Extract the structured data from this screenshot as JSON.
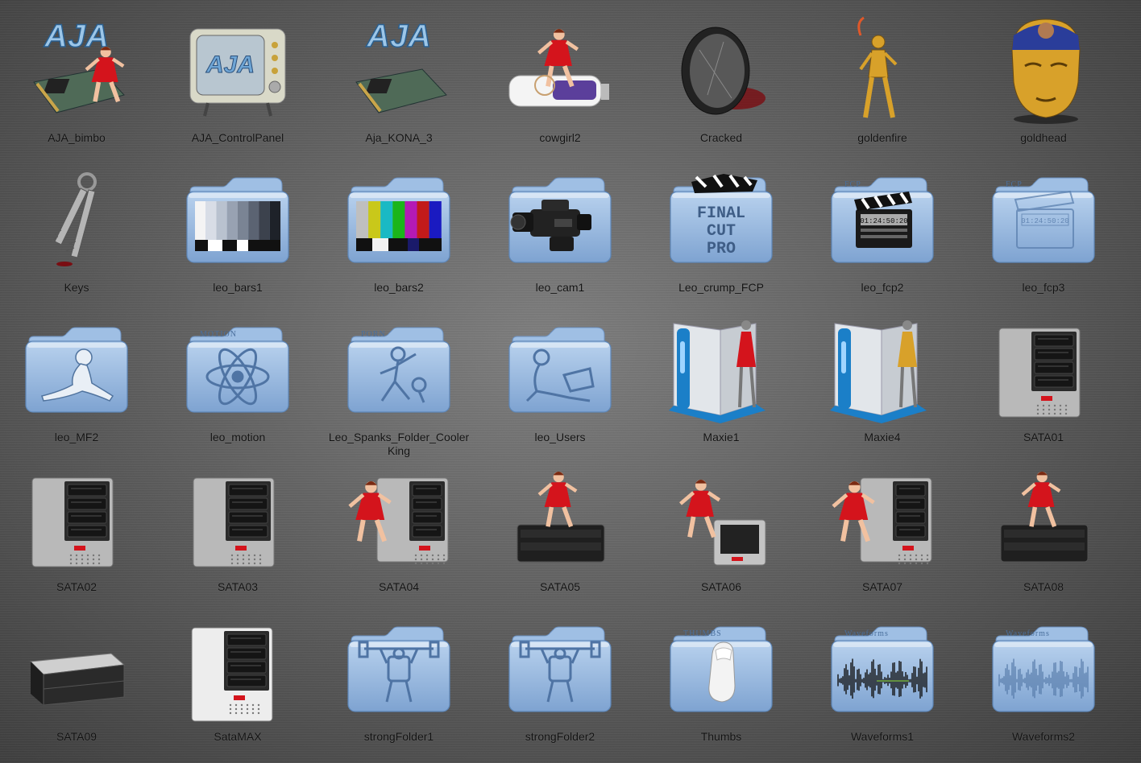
{
  "colors": {
    "folder_blue": "#8fb3dc",
    "folder_blue_dark": "#5d86b8",
    "server_gray": "#b8b8b8",
    "server_dark": "#1e1e1e",
    "pinup_red": "#d4141c",
    "skin": "#f1c1a0",
    "gold": "#d8a12a"
  },
  "icons": [
    {
      "label": "AJA_bimbo",
      "kind": "card",
      "logo": "AJA",
      "figure": true
    },
    {
      "label": "AJA_ControlPanel",
      "kind": "tv",
      "logo": "AJA"
    },
    {
      "label": "Aja_KONA_3",
      "kind": "card",
      "logo": "AJA",
      "figure": false
    },
    {
      "label": "cowgirl2",
      "kind": "usb"
    },
    {
      "label": "Cracked",
      "kind": "lens"
    },
    {
      "label": "goldenfire",
      "kind": "goldfigure"
    },
    {
      "label": "goldhead",
      "kind": "goldhead"
    },
    {
      "label": "Keys",
      "kind": "keys"
    },
    {
      "label": "leo_bars1",
      "kind": "folder",
      "emblem": "graybars"
    },
    {
      "label": "leo_bars2",
      "kind": "folder",
      "emblem": "colorbars"
    },
    {
      "label": "leo_cam1",
      "kind": "folder",
      "emblem": "camera"
    },
    {
      "label": "Leo_crump_FCP",
      "kind": "folder",
      "emblem": "fcp_crumpled",
      "folder_text": [
        "FINAL",
        "CUT",
        "PRO"
      ]
    },
    {
      "label": "leo_fcp2",
      "kind": "folder",
      "emblem": "clapper",
      "tab_text": "FCP",
      "clapper_text": "01:24:50:20"
    },
    {
      "label": "leo_fcp3",
      "kind": "folder",
      "emblem": "clapper_emboss",
      "tab_text": "FCP",
      "clapper_text": "01:24:50:20"
    },
    {
      "label": "leo_MF2",
      "kind": "folder",
      "emblem": "silhouette_sit"
    },
    {
      "label": "leo_motion",
      "kind": "folder",
      "emblem": "atom",
      "tab_text": "MOTION"
    },
    {
      "label": "Leo_Spanks_Folder_Cooler King",
      "kind": "folder",
      "emblem": "silhouette_dance",
      "tab_text": "PORN"
    },
    {
      "label": "leo_Users",
      "kind": "folder",
      "emblem": "silhouette_laptop"
    },
    {
      "label": "Maxie1",
      "kind": "drive_robot",
      "accent": "red"
    },
    {
      "label": "Maxie4",
      "kind": "drive_robot",
      "accent": "gold"
    },
    {
      "label": "SATA01",
      "kind": "server"
    },
    {
      "label": "SATA02",
      "kind": "server"
    },
    {
      "label": "SATA03",
      "kind": "server"
    },
    {
      "label": "SATA04",
      "kind": "server_pinup"
    },
    {
      "label": "SATA05",
      "kind": "server_low_pinup"
    },
    {
      "label": "SATA06",
      "kind": "server_small_pinup"
    },
    {
      "label": "SATA07",
      "kind": "server_pinup"
    },
    {
      "label": "SATA08",
      "kind": "server_low_pinup"
    },
    {
      "label": "SATA09",
      "kind": "drive_flat"
    },
    {
      "label": "SataMAX",
      "kind": "server_white"
    },
    {
      "label": "strongFolder1",
      "kind": "folder",
      "emblem": "robot"
    },
    {
      "label": "strongFolder2",
      "kind": "folder",
      "emblem": "robot"
    },
    {
      "label": "Thumbs",
      "kind": "folder",
      "emblem": "thumb",
      "tab_text": "THUMBS"
    },
    {
      "label": "Waveforms1",
      "kind": "folder",
      "emblem": "waveform",
      "tab_text": "Waveforms"
    },
    {
      "label": "Waveforms2",
      "kind": "folder",
      "emblem": "waveform_emboss",
      "tab_text": "Waveforms"
    }
  ]
}
